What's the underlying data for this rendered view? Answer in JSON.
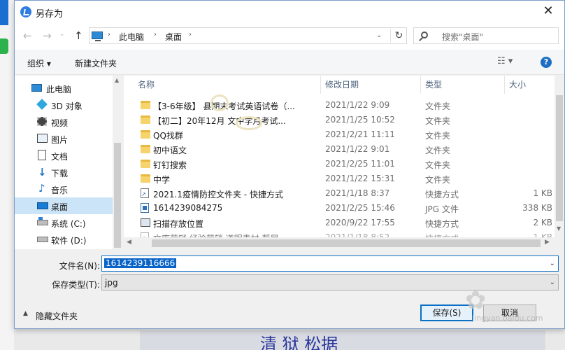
{
  "window": {
    "title": "另存为",
    "close": "✕"
  },
  "nav": {
    "back": "←",
    "forward": "→",
    "recent": "⌄",
    "up": "↑",
    "breadcrumb": [
      "›",
      "此电脑",
      "›",
      "桌面",
      "›"
    ],
    "address_dropdown": "⌄",
    "refresh": "↻",
    "search_placeholder": "搜索\"桌面\""
  },
  "toolbar": {
    "organize": "组织 ▾",
    "new_folder": "新建文件夹",
    "view": "☷ ▾",
    "help": "?"
  },
  "sidebar": {
    "items": [
      {
        "label": "此电脑",
        "icon": "computer-icon"
      },
      {
        "label": "3D 对象",
        "icon": "3d-objects-icon"
      },
      {
        "label": "视频",
        "icon": "video-icon"
      },
      {
        "label": "图片",
        "icon": "pictures-icon"
      },
      {
        "label": "文档",
        "icon": "documents-icon"
      },
      {
        "label": "下载",
        "icon": "download-icon"
      },
      {
        "label": "音乐",
        "icon": "music-icon"
      },
      {
        "label": "桌面",
        "icon": "desktop-icon",
        "selected": true
      },
      {
        "label": "系统 (C:)",
        "icon": "drive-c-icon"
      },
      {
        "label": "软件 (D:)",
        "icon": "drive-d-icon"
      }
    ]
  },
  "columns": {
    "name": "名称",
    "date": "修改日期",
    "type": "类型",
    "size": "大小",
    "sort_arrow": "^"
  },
  "files": [
    {
      "name": "【3-6年级】   县期末考试英语试卷（...",
      "date": "2021/1/22 9:09",
      "type": "文件夹",
      "size": "",
      "icon": "folder-icon"
    },
    {
      "name": "【初二】20年12月    文中学月考试...",
      "date": "2021/1/25 10:52",
      "type": "文件夹",
      "size": "",
      "icon": "folder-icon"
    },
    {
      "name": "QQ找群",
      "date": "2021/2/21 11:11",
      "type": "文件夹",
      "size": "",
      "icon": "folder-icon"
    },
    {
      "name": "初中语文",
      "date": "2021/1/22 9:01",
      "type": "文件夹",
      "size": "",
      "icon": "folder-icon"
    },
    {
      "name": "钉钉搜索",
      "date": "2021/2/25 11:01",
      "type": "文件夹",
      "size": "",
      "icon": "folder-icon"
    },
    {
      "name": "中学",
      "date": "2021/1/22 15:31",
      "type": "文件夹",
      "size": "",
      "icon": "folder-icon"
    },
    {
      "name": "2021.1疫情防控文件夹 - 快捷方式",
      "date": "2021/1/18 8:37",
      "type": "快捷方式",
      "size": "1 KB",
      "icon": "shortcut-icon"
    },
    {
      "name": "1614239084275",
      "date": "2021/2/25 15:46",
      "type": "JPG 文件",
      "size": "338 KB",
      "icon": "image-file-icon"
    },
    {
      "name": "扫描存放位置",
      "date": "2020/9/22 17:55",
      "type": "快捷方式",
      "size": "2 KB",
      "icon": "shortcut-icon"
    },
    {
      "name": "文库营销    经验营销    道明素材 帮届",
      "date": "2021/1/18 8:52",
      "type": "快捷方式",
      "size": "1 KB",
      "icon": "shortcut-icon"
    }
  ],
  "scroll": {
    "left": "◀",
    "right": "▶",
    "up": "▲",
    "down": "▼"
  },
  "form": {
    "filename_label": "文件名(N):",
    "filename_value": "1614239116666",
    "filetype_label": "保存类型(T):",
    "filetype_value": "jpg",
    "dropdown": "⌄"
  },
  "footer": {
    "hide_chevron": "▲",
    "hide_folders": "隐藏文件夹",
    "save": "保存(S)",
    "cancel": "取消"
  },
  "watermark": {
    "logo": "✿",
    "text": "jingyan.baidu.com"
  },
  "background": {
    "handwriting": "清  狱  松据"
  }
}
